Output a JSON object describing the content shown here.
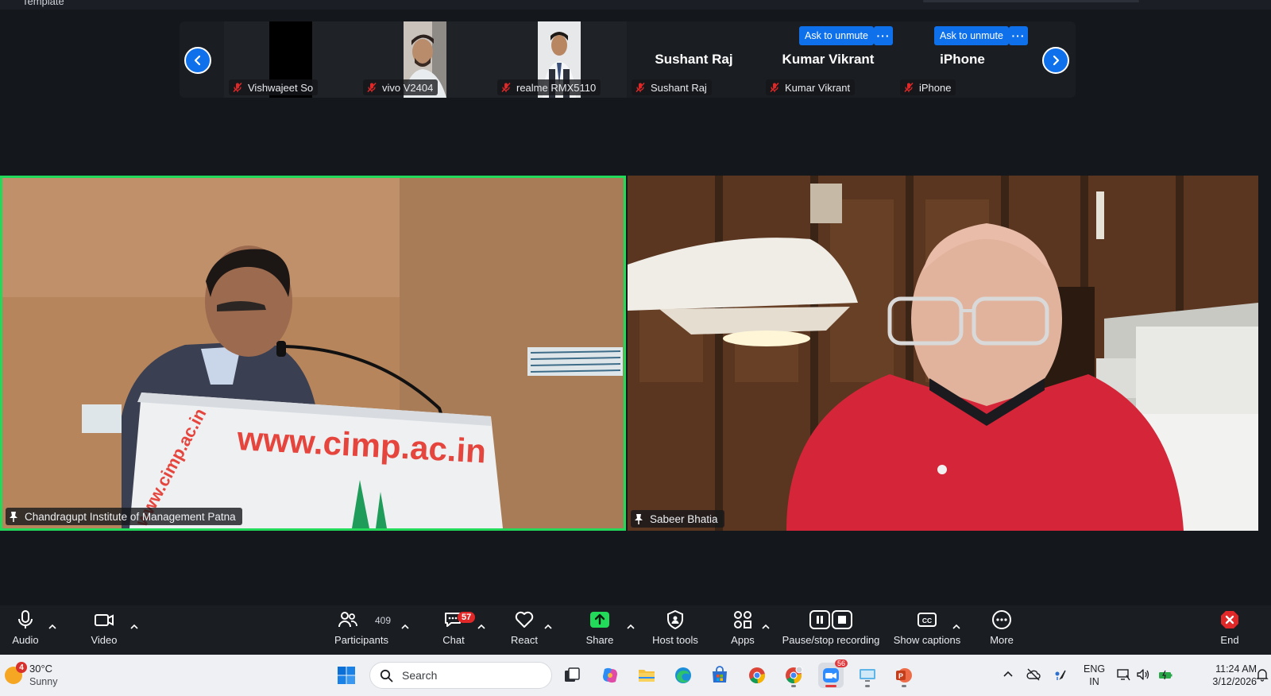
{
  "window": {
    "title_partial": "Template"
  },
  "gallery": {
    "tiles": [
      {
        "label": "Vishwajeet So",
        "big_name": ""
      },
      {
        "label": "vivo V2404",
        "big_name": ""
      },
      {
        "label": "realme RMX5110",
        "big_name": ""
      },
      {
        "label": "Sushant Raj",
        "big_name": "Sushant Raj"
      },
      {
        "label": "Kumar Vikrant",
        "big_name": "Kumar Vikrant"
      },
      {
        "label": "iPhone",
        "big_name": "iPhone"
      }
    ],
    "ask_to_unmute_label": "Ask to unmute",
    "more_label": "···"
  },
  "main_videos": [
    {
      "label": "Chandragupt Institute of Management Patna",
      "podium_text": "www.cimp.ac.in",
      "podium_side_text": "www.cimp.ac.in"
    },
    {
      "label": "Sabeer Bhatia"
    }
  ],
  "toolbar": {
    "audio": "Audio",
    "video": "Video",
    "participants": "Participants",
    "participants_count": "409",
    "chat": "Chat",
    "chat_badge": "57",
    "react": "React",
    "share": "Share",
    "host_tools": "Host tools",
    "apps": "Apps",
    "recording": "Pause/stop recording",
    "captions": "Show captions",
    "more": "More",
    "end": "End"
  },
  "taskbar": {
    "weather_badge": "4",
    "temperature": "30°C",
    "condition": "Sunny",
    "search_placeholder": "Search",
    "zoom_badge": "56",
    "lang_line1": "ENG",
    "lang_line2": "IN",
    "time": "11:24 AM",
    "date": "3/12/2026"
  },
  "colors": {
    "accent_blue": "#0e71eb",
    "active_speaker": "#23d959",
    "share_green": "#23d959",
    "end_red": "#e02828"
  }
}
